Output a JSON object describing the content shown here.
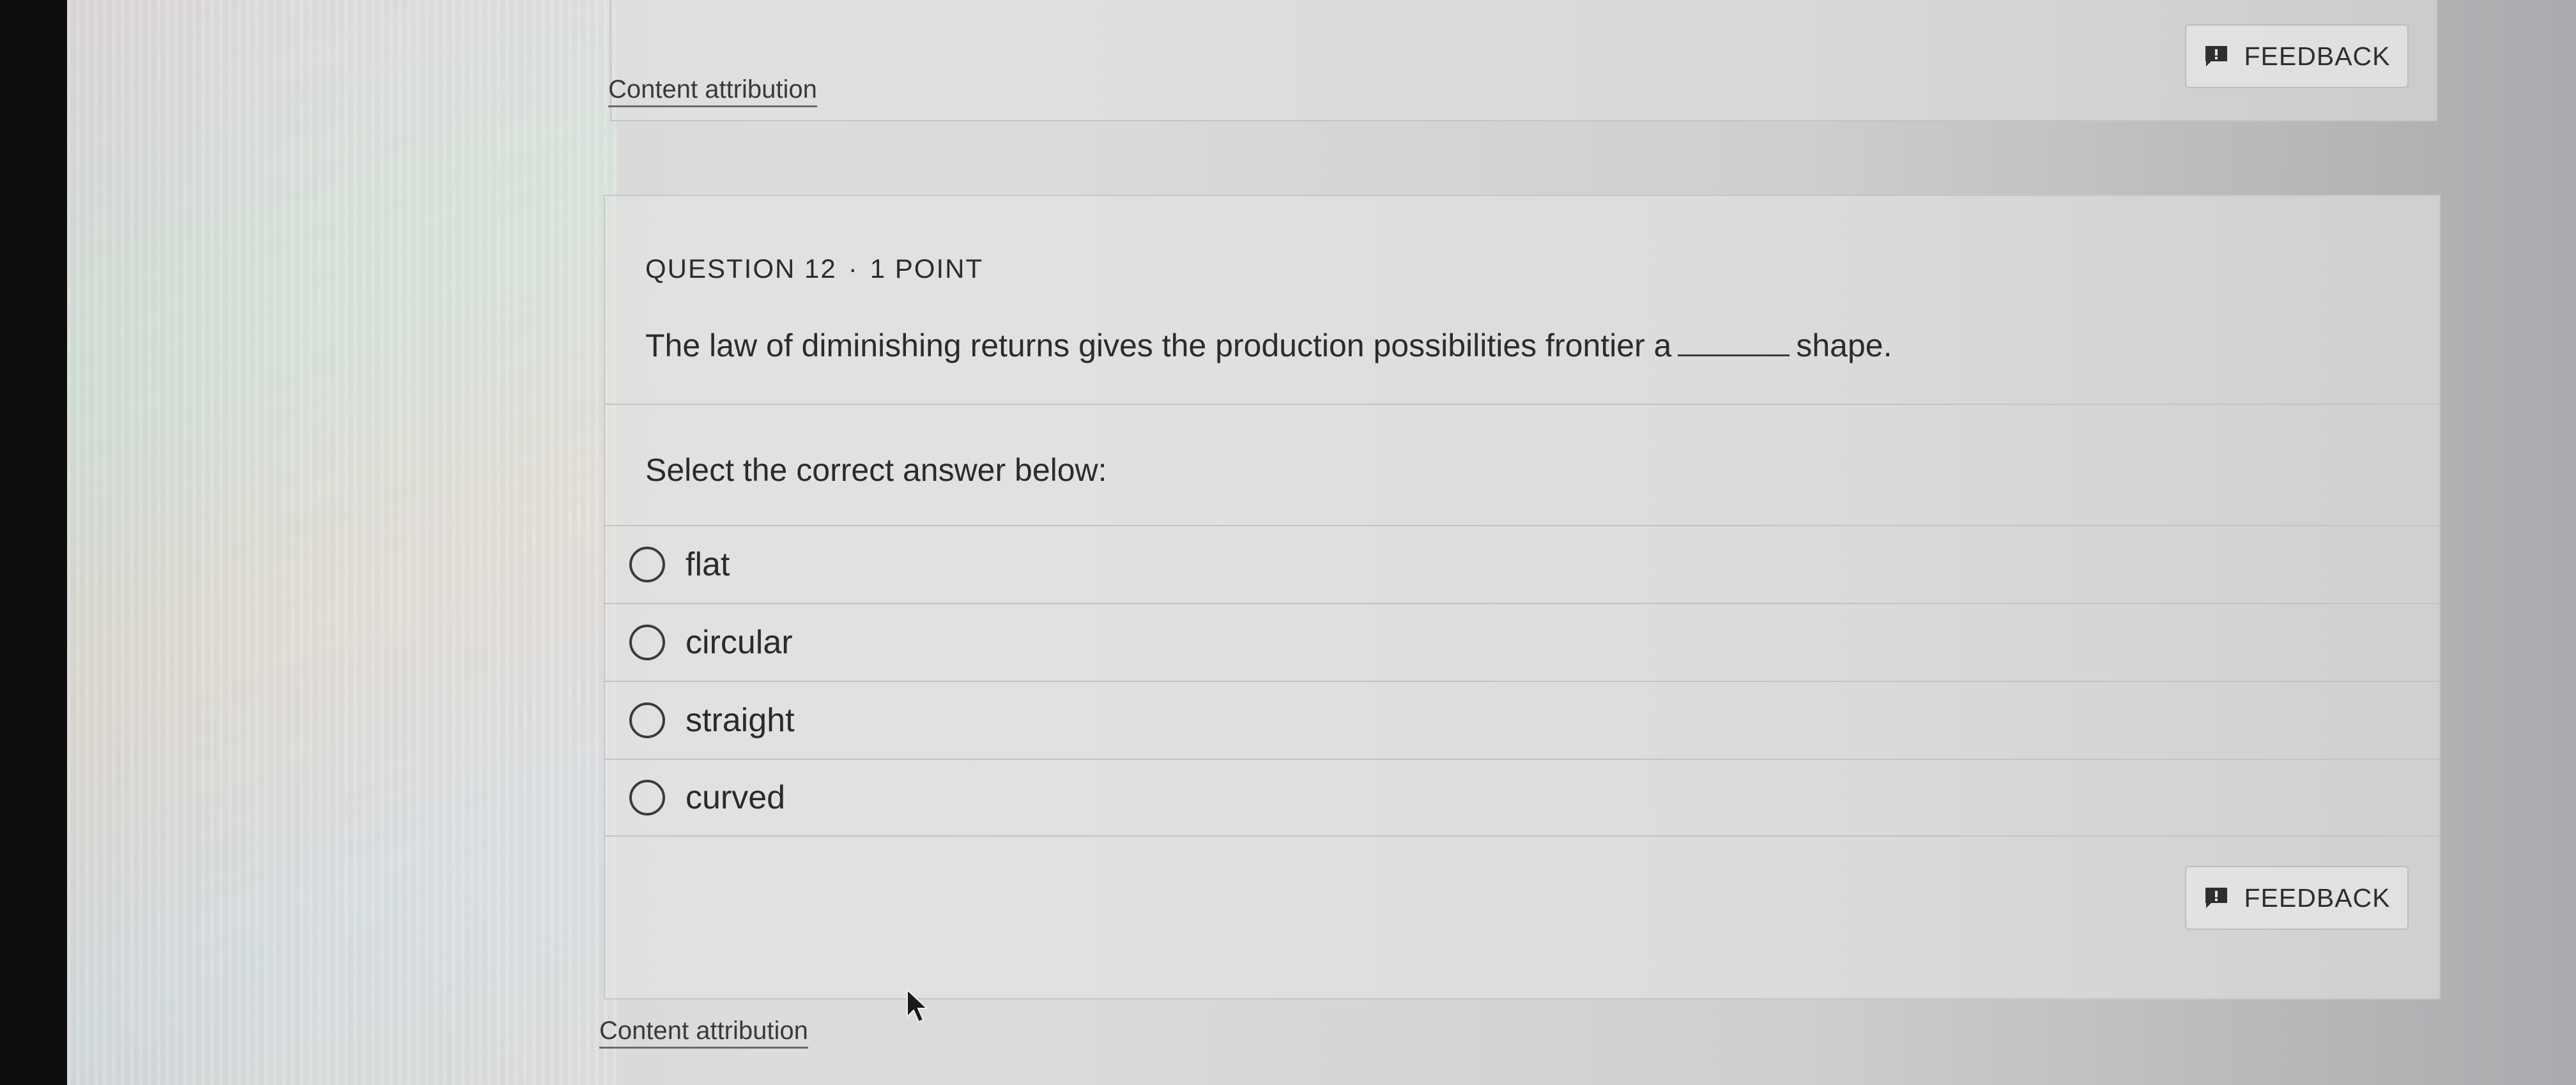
{
  "top": {
    "attribution": "Content attribution",
    "feedback": "FEEDBACK"
  },
  "question": {
    "header_number": "QUESTION 12",
    "header_separator": "·",
    "header_points": "1 POINT",
    "text_before": "The law of diminishing returns gives the production possibilities frontier a",
    "text_after": "shape.",
    "prompt": "Select the correct answer below:",
    "options": [
      {
        "label": "flat"
      },
      {
        "label": "circular"
      },
      {
        "label": "straight"
      },
      {
        "label": "curved"
      }
    ],
    "feedback": "FEEDBACK"
  },
  "bottom": {
    "attribution": "Content attribution"
  },
  "icons": {
    "feedback": "feedback-icon",
    "radio": "radio-empty",
    "cursor": "mouse-pointer-icon"
  }
}
